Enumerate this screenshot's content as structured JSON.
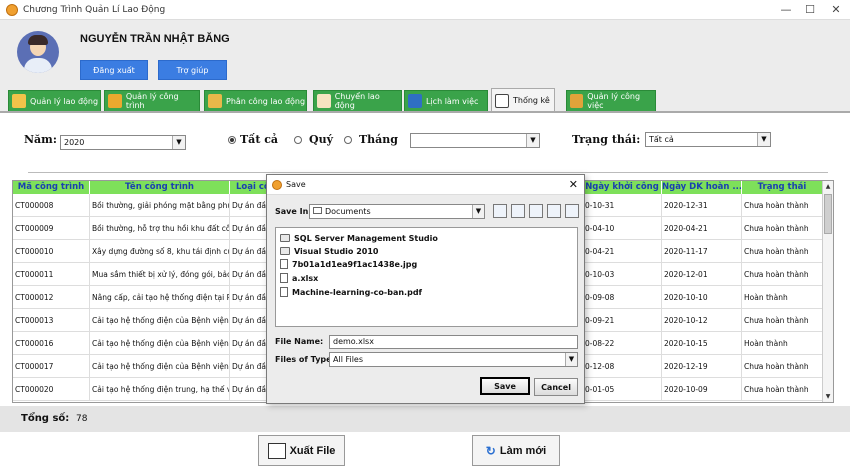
{
  "window": {
    "title": "Chương Trình Quản Lí Lao Động",
    "minimize": "—",
    "maximize": "☐",
    "close": "✕"
  },
  "header": {
    "username": "NGUYỄN TRẦN NHẬT BĂNG",
    "logout_label": "Đăng xuất",
    "help_label": "Trợ giúp"
  },
  "tabs": [
    {
      "label": "Quản lý lao động"
    },
    {
      "label": "Quản lý công trình"
    },
    {
      "label": "Phân công lao động"
    },
    {
      "label": "Chuyển lao động"
    },
    {
      "label": "Lịch làm việc"
    },
    {
      "label": "Thống kê"
    },
    {
      "label": "Quản lý công việc"
    }
  ],
  "filters": {
    "year_label": "Năm:",
    "year_value": "2020",
    "radio_all": "Tất cả",
    "radio_quarter": "Quý",
    "radio_month": "Tháng",
    "period_value": "",
    "status_label": "Trạng thái:",
    "status_value": "Tất cả"
  },
  "table": {
    "columns": [
      "Mã công trình",
      "Tên công trình",
      "Loại cô",
      "Ngày khởi công",
      "Ngày DK hoàn ...",
      "Trạng thái"
    ],
    "rows": [
      [
        "CT000008",
        "Bồi thường, giải phóng mặt bằng phụ...",
        "Dự án đầu",
        "0-10-31",
        "2020-12-31",
        "Chưa hoàn thành"
      ],
      [
        "CT000009",
        "Bồi thường, hỗ trợ thu hồi khu đất côn...",
        "Dự án đầu",
        "0-04-10",
        "2020-04-21",
        "Chưa hoàn thành"
      ],
      [
        "CT000010",
        "Xây dựng đường số 8, khu tái định cư ...",
        "Dự án đầu",
        "0-04-21",
        "2020-11-17",
        "Chưa hoàn thành"
      ],
      [
        "CT000011",
        "Mua sắm thiết bị xử lý, đóng gói, bảo ...",
        "Dự án đầu",
        "0-10-03",
        "2020-12-01",
        "Chưa hoàn thành"
      ],
      [
        "CT000012",
        "Nâng cấp, cải tạo hệ thống điện tại Ph...",
        "Dự án đầu",
        "0-09-08",
        "2020-10-10",
        "Hoàn thành"
      ],
      [
        "CT000013",
        "Cải tạo hệ thống điện của Bệnh viện q...",
        "Dự án đầu",
        "0-09-21",
        "2020-10-12",
        "Chưa hoàn thành"
      ],
      [
        "CT000016",
        "Cải tạo hệ thống điện của Bệnh viện ...",
        "Dự án đầu",
        "0-08-22",
        "2020-10-15",
        "Hoàn thành"
      ],
      [
        "CT000017",
        "Cải tạo hệ thống điện của Bệnh viện b...",
        "Dự án đầu",
        "0-12-08",
        "2020-12-19",
        "Chưa hoàn thành"
      ],
      [
        "CT000020",
        "Cải tạo hệ thống điện trung, hạ thế và ...",
        "Dự án đầu",
        "0-01-05",
        "2020-10-09",
        "Chưa hoàn thành"
      ]
    ]
  },
  "footer": {
    "total_label": "Tổng số:",
    "total_value": "78",
    "export_label": "Xuất File",
    "refresh_label": "Làm mới"
  },
  "dialog": {
    "title": "Save",
    "save_in_label": "Save In:",
    "save_in_value": "Documents",
    "files": [
      {
        "name": "SQL Server Management Studio",
        "type": "folder"
      },
      {
        "name": "Visual Studio 2010",
        "type": "folder"
      },
      {
        "name": "7b01a1d1ea9f1ac1438e.jpg",
        "type": "file"
      },
      {
        "name": "a.xlsx",
        "type": "file"
      },
      {
        "name": "Machine-learning-co-ban.pdf",
        "type": "file"
      }
    ],
    "file_name_label": "File Name:",
    "file_name_value": "demo.xlsx",
    "file_type_label": "Files of Type:",
    "file_type_value": "All Files",
    "save_label": "Save",
    "cancel_label": "Cancel"
  },
  "colors": {
    "tab_green": "#3aa34a",
    "header_green": "#7ee05a",
    "header_text": "#1a3fb0",
    "button_blue": "#3b7de2"
  }
}
